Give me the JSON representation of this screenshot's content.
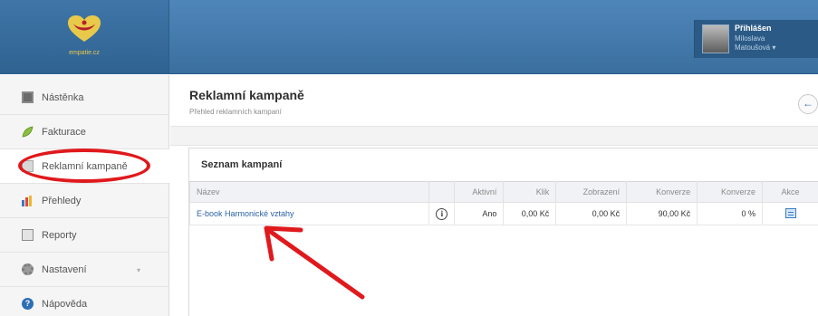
{
  "header": {
    "logo_text": "empatie.cz",
    "user": {
      "status_label": "Přihlášen",
      "name_line1": "Miloslava",
      "name_line2": "Matoušová ▾"
    }
  },
  "sidebar": {
    "items": [
      {
        "label": "Nástěnka",
        "icon": "monitor-icon"
      },
      {
        "label": "Fakturace",
        "icon": "leaf-icon"
      },
      {
        "label": "Reklamní kampaně",
        "icon": "document-icon",
        "active": true
      },
      {
        "label": "Přehledy",
        "icon": "bar-chart-icon"
      },
      {
        "label": "Reporty",
        "icon": "report-icon"
      },
      {
        "label": "Nastavení",
        "icon": "gear-icon",
        "caret": "▾"
      },
      {
        "label": "Nápověda",
        "icon": "help-icon",
        "icon_glyph": "?"
      }
    ]
  },
  "main": {
    "title": "Reklamní kampaně",
    "subtitle": "Přehled reklamních kampaní",
    "back_glyph": "←",
    "panel": {
      "title": "Seznam kampaní",
      "columns": [
        "Název",
        "",
        "Aktivní",
        "Klik",
        "Zobrazení",
        "Konverze",
        "Konverze",
        "Akce"
      ],
      "rows": [
        {
          "name": "E-book Harmonické vztahy",
          "info_glyph": "i",
          "active": "Ano",
          "click": "0,00 Kč",
          "impressions": "0,00 Kč",
          "conversions_value": "90,00 Kč",
          "conversions_pct": "0 %",
          "action_icon": "edit-list-icon"
        }
      ]
    }
  },
  "colors": {
    "header_blue": "#3a6f9f",
    "annotation_red": "#e0191c",
    "link_blue": "#2a62a8"
  }
}
